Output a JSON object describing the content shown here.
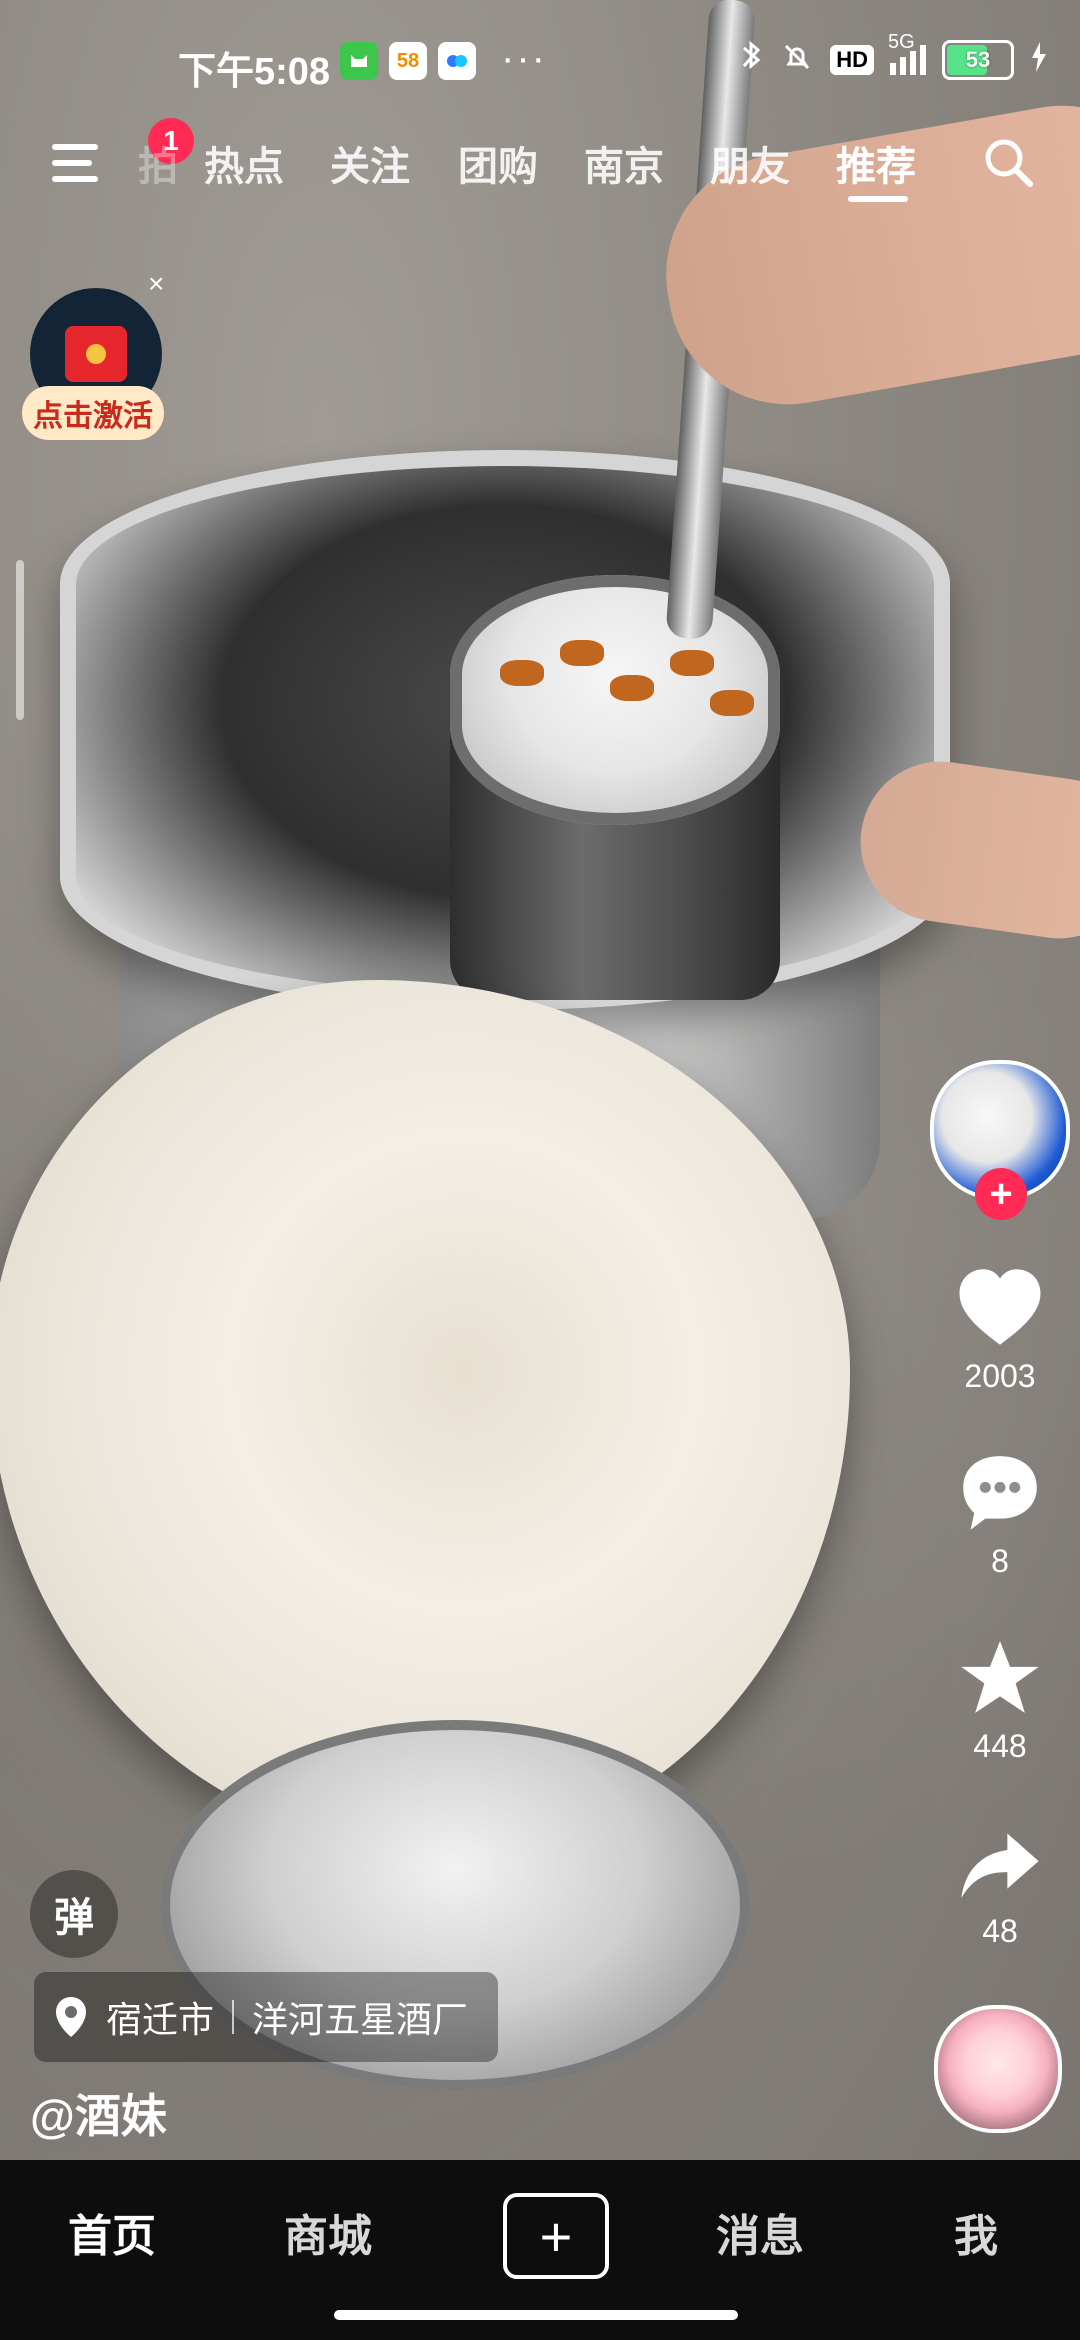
{
  "status_bar": {
    "time": "下午5:08",
    "app_icons": [
      "cat-app-icon",
      "58-app-icon",
      "cloud-app-icon"
    ],
    "app_icon_text": [
      "",
      "58",
      ""
    ],
    "more": "···",
    "network": "5G",
    "hd": "HD",
    "battery": "53"
  },
  "top_nav": {
    "badge": "1",
    "tabs": [
      "热点",
      "关注",
      "团购",
      "南京",
      "朋友",
      "推荐"
    ],
    "partial_tab": "拍",
    "active_tab": "推荐"
  },
  "redpacket": {
    "label": "点击激活",
    "close": "×"
  },
  "actions": {
    "likes": "2003",
    "comments": "8",
    "favorites": "448",
    "shares": "48",
    "follow_plus": "+"
  },
  "video_info": {
    "danmu_label": "弹",
    "location_city": "宿迁市",
    "location_place": "洋河五星酒厂",
    "username": "@酒妹"
  },
  "bottom_bar": {
    "tabs": [
      "首页",
      "商城",
      "消息",
      "我"
    ],
    "plus": "+"
  },
  "colors": {
    "accent_red": "#ff2b54",
    "battery_green": "#57e389",
    "bottom_bar_bg": "#0d0d0d"
  }
}
